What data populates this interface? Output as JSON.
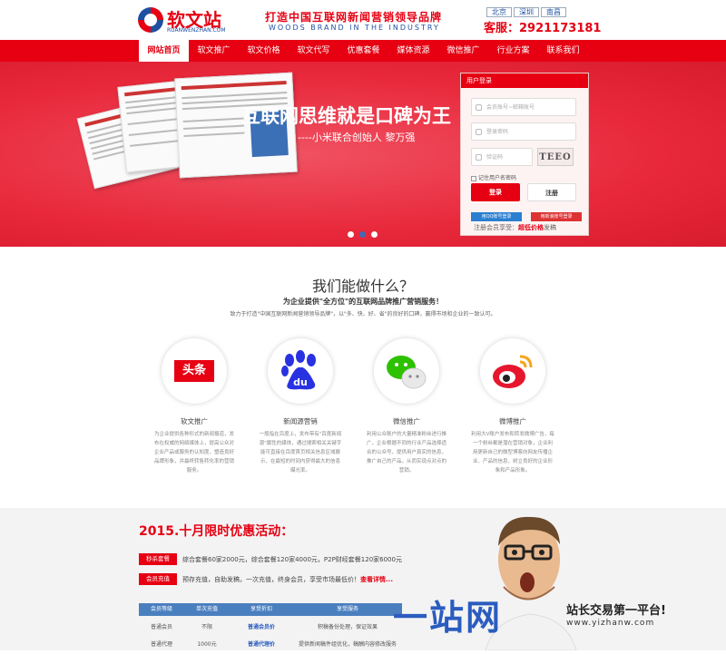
{
  "header": {
    "logo_text": "软文站",
    "logo_sub": "RUANWENZHAN.COM",
    "slogan": "打造中国互联网新闻营销领导品牌",
    "slogan_en": "WOODS BRAND IN THE INDUSTRY",
    "cities": [
      "北京",
      "深圳",
      "南昌"
    ],
    "hotline": "客服：2921173181"
  },
  "nav": {
    "items": [
      "网站首页",
      "软文推广",
      "软文价格",
      "软文代写",
      "优惠套餐",
      "媒体资源",
      "微信推广",
      "行业方案",
      "联系我们"
    ],
    "active_index": 0
  },
  "hero": {
    "title": "互联网思维就是口碑为王",
    "subtitle": "----小米联合创始人 黎万强",
    "slide_count": 3,
    "active_slide": 1
  },
  "login": {
    "header": "用户登录",
    "account_placeholder": "会员账号~邮箱账号",
    "password_placeholder": "登录密码",
    "captcha_placeholder": "验证码",
    "captcha_text": "TEEO",
    "remember_label": "记住用户名密码",
    "login_button": "登录",
    "register_button": "注册",
    "qq_login": "用QQ账号登录",
    "weibo_login": "用新浪账号登录",
    "note_prefix": "注册会员享受：",
    "note_highlight": "超低价格",
    "note_suffix": "发稿"
  },
  "services": {
    "title": "我们能做什么？",
    "subtitle": "为企业提供\"全方位\"的互联网品牌推广营销服务！",
    "description": "致力于打造\"中国互联网新闻营销领导品牌\"，以\"多、快、好、省\"的良好的口碑，赢得市场和企业的一致认可。",
    "items": [
      {
        "name": "软文推广",
        "icon": "toutiao-icon",
        "icon_text": "头条",
        "desc": "为企业提供各种形式的新闻报道，发布在权威的网络媒体上，提高公众对企业产品或服务的认知度，塑造良好品牌形象，并最终转售转化率的营销服务。"
      },
      {
        "name": "新闻源营销",
        "icon": "baidu-icon",
        "icon_text": "du",
        "desc": "一般指在百度上，发布带有\"百度新闻源\"属性的媒体，通过搜索相关关键字能可直接在百度首页相关信息区域展示，在最短的时间内获得最大的信息曝光率。"
      },
      {
        "name": "微信推广",
        "icon": "wechat-icon",
        "icon_text": "",
        "desc": "利用公众账户的大量精准粉丝进行推广，企业根据不同的行业产品选择适合的公众号，提供用户真实的信息，推广自己的产品，从而实现点对点的营销。"
      },
      {
        "name": "微博推广",
        "icon": "weibo-icon",
        "icon_text": "",
        "desc": "利用大V账户发布和转发微博广告，每一个粉丝都是潜在营销对象，企业利用更新自己的微型博客向网友传播企业、产品的信息，树立良好的企业形象和产品形象。"
      }
    ]
  },
  "promo": {
    "title": "2015.十月限时优惠活动：",
    "rows": [
      {
        "tag": "秒杀套餐",
        "text": "综合套餐60家2000元，综合套餐120家4000元，P2P财经套餐120家6000元",
        "link": ""
      },
      {
        "tag": "会员充值",
        "text": "预存充值，自助发稿，一次充值，终身会员，享受市场最低价！",
        "link": "查看详情..."
      }
    ],
    "table": {
      "headers": [
        "会员等级",
        "单次充值",
        "享受折扣",
        "享受服务"
      ],
      "rows": [
        [
          "普通会员",
          "不限",
          "普通会员价",
          "积稿备份处理，保证效果"
        ],
        [
          "普通代理",
          "1000元",
          "普通代理价",
          "提供新闻稿件组优化，稿酬内容修改服务"
        ]
      ]
    }
  },
  "watermark": {
    "brand": "一站网",
    "tagline": "站长交易第一平台!",
    "url": "www.yizhanw.com"
  }
}
